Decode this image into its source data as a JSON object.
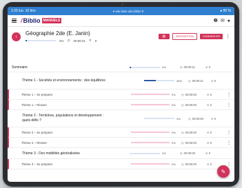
{
  "statusbar": {
    "left": "1:25 lun. 10 févr.",
    "url": "● site.fake-site.biblio.fr",
    "right": "● 80 %"
  },
  "app": {
    "logo_prefix": "Biblio",
    "logo_badge": "MANUELS"
  },
  "header": {
    "title": "Géographie 2de (E. Janin)",
    "progress_pct": "4%",
    "time": "00:00:21",
    "x_count": "0",
    "progress_fraction": 0.04,
    "btn_icon": "▤",
    "btn_outline": "DESCRIPTION",
    "btn_fill": "COMMENCER"
  },
  "rows": [
    {
      "type": "summary",
      "label": "Sommaire",
      "pct": "4%",
      "time": "00:00:21",
      "x": "0",
      "fill": 0.04,
      "bar": "blue"
    },
    {
      "type": "chapter",
      "label": "Thème 1 - Sociétés et environnements : des équilibres",
      "pct": "38%",
      "time": "00:00:21",
      "x": "0",
      "fill": 0.38,
      "bar": "blue"
    },
    {
      "type": "sub",
      "label": "Thème 1 – Se préparer",
      "pct": "0%",
      "time": "00:00:00",
      "x": "0",
      "fill": 0,
      "bar": "pink"
    },
    {
      "type": "sub",
      "label": "Thème 1 – Réviser",
      "pct": "0%",
      "time": "00:00:00",
      "x": "0",
      "fill": 0,
      "bar": "pink"
    },
    {
      "type": "chapter",
      "label": "Thème 2 - Territoires, populations et développement : quels défis ?",
      "pct": "0%",
      "time": "00:00:00",
      "x": "0",
      "fill": 0,
      "bar": "blue"
    },
    {
      "type": "sub",
      "label": "Thème 2 – Se préparer",
      "pct": "0%",
      "time": "00:00:00",
      "x": "0",
      "fill": 0,
      "bar": "pink"
    },
    {
      "type": "sub",
      "label": "Thème 2 – Réviser",
      "pct": "0%",
      "time": "00:00:00",
      "x": "0",
      "fill": 0,
      "bar": "pink"
    },
    {
      "type": "chapter",
      "label": "Thème 3 - Des mobilités généralisées",
      "pct": "0%",
      "time": "00:00:00",
      "x": "0",
      "fill": 0,
      "bar": "blue"
    },
    {
      "type": "sub",
      "label": "Thème 3 – Se préparer",
      "pct": "0%",
      "time": "00:00:00",
      "x": "0",
      "fill": 0,
      "bar": "pink"
    }
  ],
  "colors": {
    "accent": "#d2335b",
    "blue": "#2c5aa0",
    "status": "#2f7fd0"
  }
}
